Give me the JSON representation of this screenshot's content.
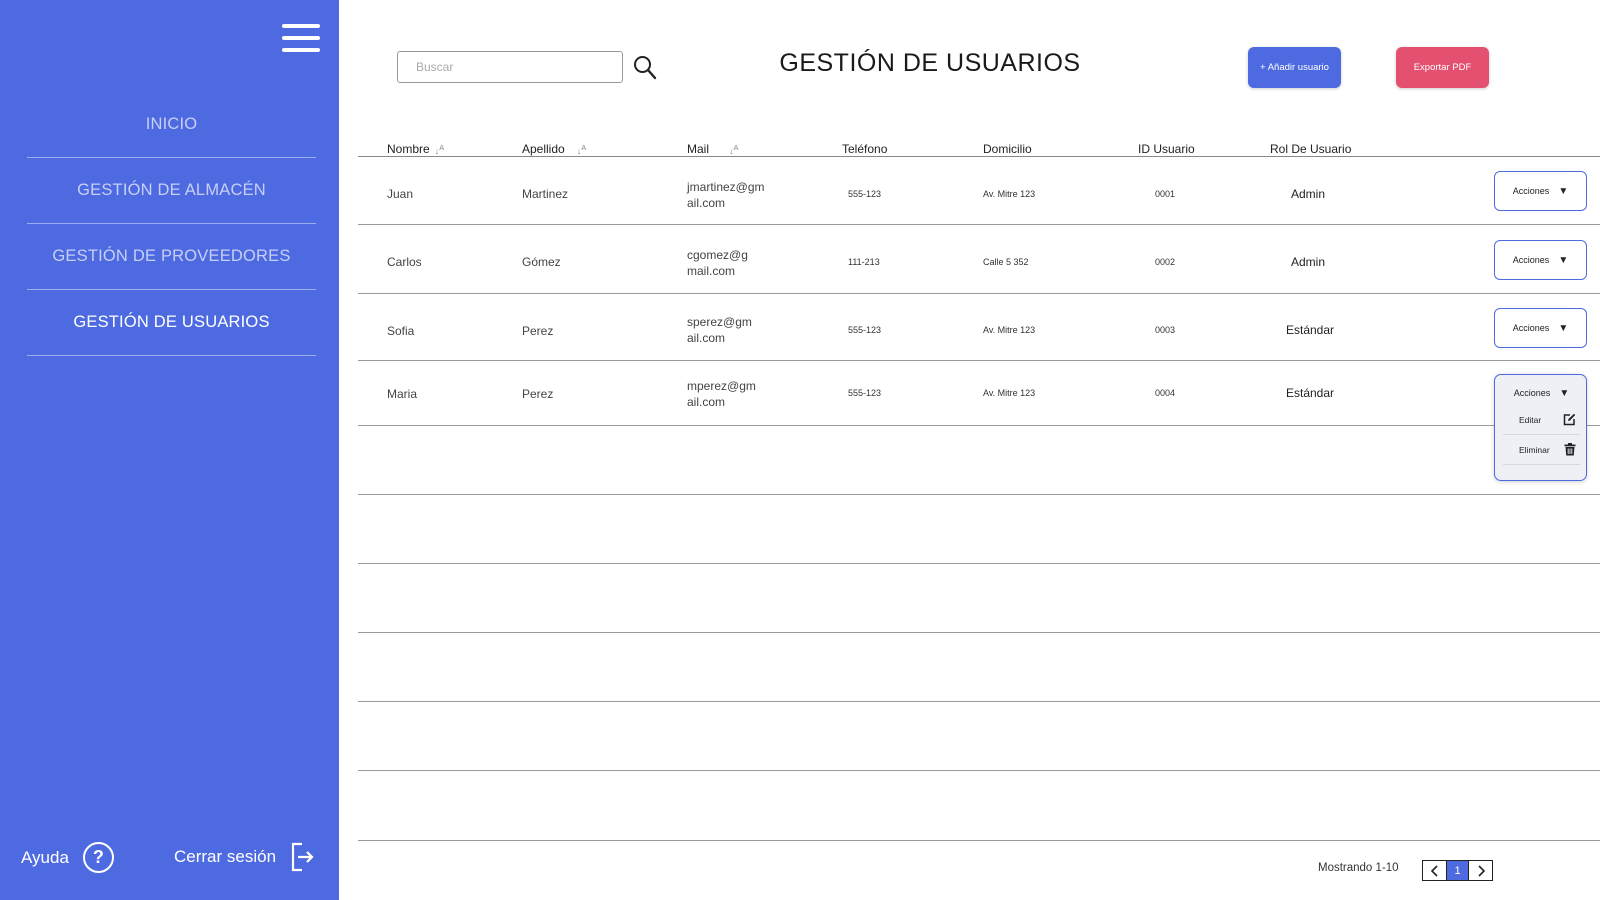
{
  "sidebar": {
    "menu_icon": "hamburger-menu-icon",
    "items": [
      {
        "label": "INICIO"
      },
      {
        "label": "GESTIÓN DE ALMACÉN"
      },
      {
        "label": "GESTIÓN DE PROVEEDORES"
      },
      {
        "label": "GESTIÓN DE USUARIOS"
      }
    ],
    "active_item": "GESTIÓN DE USUARIOS",
    "help_label": "Ayuda",
    "help_icon": "question-circle-icon",
    "logout_label": "Cerrar sesión",
    "logout_icon": "logout-icon",
    "background_color": "#4e6ae1"
  },
  "header": {
    "search_placeholder": "Buscar",
    "search_value": "",
    "search_icon": "magnifier-icon",
    "title": "GESTIÓN DE USUARIOS",
    "add_user_label": "+ Añadir usuario",
    "export_pdf_label": "Exportar PDF",
    "add_color": "#4e6ae1",
    "export_color": "#e35070"
  },
  "table": {
    "columns": [
      "Nombre",
      "Apellido",
      "Mail",
      "Teléfono",
      "Domicilio",
      "ID Usuario",
      "Rol De Usuario"
    ],
    "sortable_icon": "sort-az-icon",
    "rows": [
      {
        "nombre": "Juan",
        "apellido": "Martinez",
        "mail_l1": "jmartinez@gm",
        "mail_l2": "ail.com",
        "telefono": "555-123",
        "domicilio": "Av. Mitre 123",
        "id": "0001",
        "rol": "Admin",
        "actions_label": "Acciones"
      },
      {
        "nombre": "Carlos",
        "apellido": "Gómez",
        "mail_l1": "cgomez@g",
        "mail_l2": "mail.com",
        "telefono": "111-213",
        "domicilio": "Calle 5 352",
        "id": "0002",
        "rol": "Admin",
        "actions_label": "Acciones"
      },
      {
        "nombre": "Sofia",
        "apellido": "Perez",
        "mail_l1": "sperez@gm",
        "mail_l2": "ail.com",
        "telefono": "555-123",
        "domicilio": "Av. Mitre 123",
        "id": "0003",
        "rol": "Estándar",
        "actions_label": "Acciones"
      },
      {
        "nombre": "Maria",
        "apellido": "Perez",
        "mail_l1": "mperez@gm",
        "mail_l2": "ail.com",
        "telefono": "555-123",
        "domicilio": "Av. Mitre 123",
        "id": "0004",
        "rol": "Estándar",
        "actions_label": "Acciones"
      }
    ],
    "dropdown": {
      "label": "Acciones",
      "items": [
        {
          "label": "Editar",
          "icon": "edit-icon"
        },
        {
          "label": "Eliminar",
          "icon": "trash-icon"
        }
      ]
    }
  },
  "pagination": {
    "showing": "Mostrando 1-10",
    "current_page": "1",
    "prev_icon": "chevron-left-icon",
    "next_icon": "chevron-right-icon"
  }
}
